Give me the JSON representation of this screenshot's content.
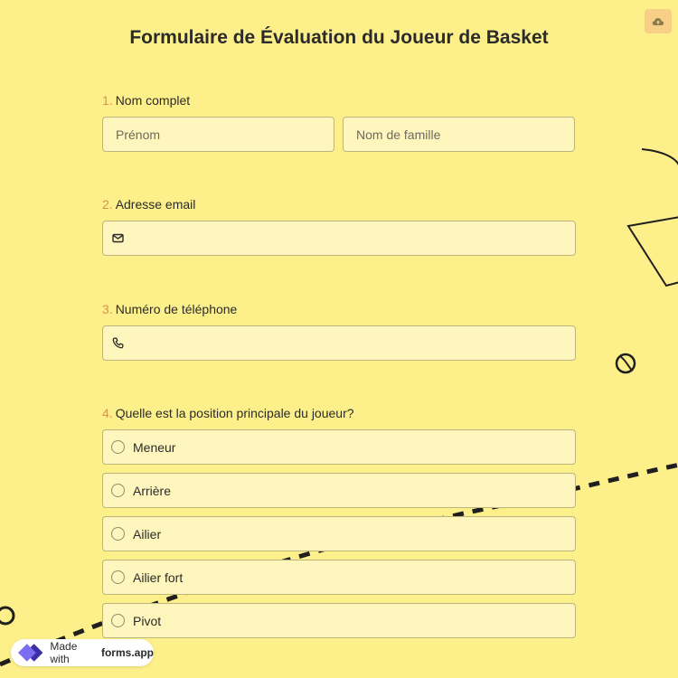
{
  "header": {
    "title": "Formulaire de Évaluation du Joueur de Basket",
    "save_icon": "cloud-icon"
  },
  "questions": {
    "name": {
      "number": "1.",
      "label": "Nom complet",
      "first_placeholder": "Prénom",
      "last_placeholder": "Nom de famille"
    },
    "email": {
      "number": "2.",
      "label": "Adresse email",
      "icon": "envelope-icon"
    },
    "phone": {
      "number": "3.",
      "label": "Numéro de téléphone",
      "icon": "phone-icon"
    },
    "position": {
      "number": "4.",
      "label": "Quelle est la position principale du joueur?",
      "options": [
        "Meneur",
        "Arrière",
        "Ailier",
        "Ailier fort",
        "Pivot"
      ]
    }
  },
  "badge": {
    "prefix": "Made with",
    "brand": "forms.app"
  },
  "colors": {
    "background": "#fdf08a",
    "field": "#fff6bd",
    "number_accent": "#d8924a",
    "save_button": "#f8cf87"
  }
}
